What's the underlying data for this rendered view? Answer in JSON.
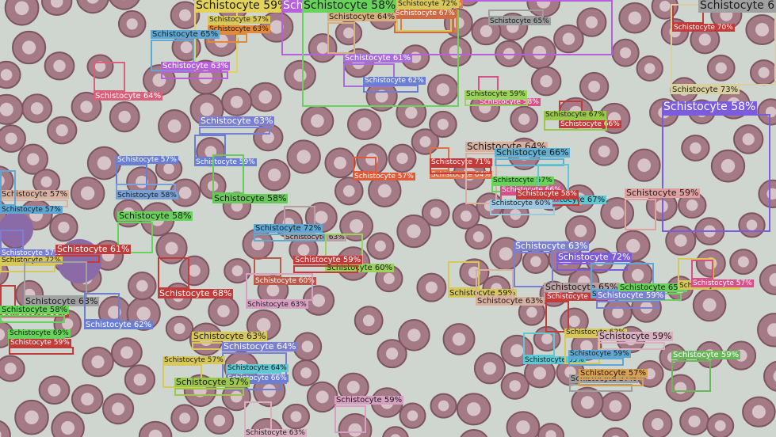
{
  "image": {
    "colors": {
      "background": "#cfd6d0",
      "cell_fill": "#a37a86",
      "cell_rim": "#7c5560",
      "cell_center": "#d7c4c8"
    },
    "detections": [
      {
        "label": "Schistocyte 57%",
        "color": "#6a7fd3"
      },
      {
        "label": "Schistocyte 59%",
        "color": "#e3d35a"
      },
      {
        "label": "Schistocyte 57%",
        "color": "#d8c85a"
      },
      {
        "label": "Schistocyte 63%",
        "color": "#e08a3a"
      },
      {
        "label": "Schistocyte 57%",
        "color": "#b85fdc"
      },
      {
        "label": "Schistocyte 58%",
        "color": "#68d35a"
      },
      {
        "label": "Schistocyte 58%",
        "color": "#e57a3d"
      },
      {
        "label": "Schistocyte 72%",
        "color": "#d8c85a"
      },
      {
        "label": "Schistocyte 67%",
        "color": "#d06a42"
      },
      {
        "label": "Schistocyte 64%",
        "color": "#d8b080"
      },
      {
        "label": "Schistocyte 65%",
        "color": "#9e9e9e"
      },
      {
        "label": "Schistocyte 65%",
        "color": "#5fa8d3"
      },
      {
        "label": "Schistocyte 63%",
        "color": "#b85fdc"
      },
      {
        "label": "Schistocyte 64%",
        "color": "#d8607a"
      },
      {
        "label": "Schistocyte 61%",
        "color": "#a86ddb"
      },
      {
        "label": "Schistocyte 62%",
        "color": "#6a7fd3"
      },
      {
        "label": "Schistocyte 58%",
        "color": "#d8508a"
      },
      {
        "label": "Schistocyte 59%",
        "color": "#9bd35a"
      },
      {
        "label": "Schistocyte 66%",
        "color": "#c23b3b"
      },
      {
        "label": "Schistocyte 67%",
        "color": "#9bc84a"
      },
      {
        "label": "Schistocyte 70%",
        "color": "#c23b3b"
      },
      {
        "label": "Schistocyte 73%",
        "color": "#d8d0a0"
      },
      {
        "label": "Schistocyte 6",
        "color": "#a0a0a0"
      },
      {
        "label": "Schistocyte 58%",
        "color": "#7a5cdc"
      },
      {
        "label": "Schistocyte 63%",
        "color": "#7a7fd3"
      },
      {
        "label": "Schistocyte 59%",
        "color": "#6a7fd3"
      },
      {
        "label": "Schistocyte 58%",
        "color": "#68c85a"
      },
      {
        "label": "Schistocyte 57%",
        "color": "#6a7fd3"
      },
      {
        "label": "Schistocyte 58%",
        "color": "#7aa0d3"
      },
      {
        "label": "Schistocyte 57%",
        "color": "#e05a3a"
      },
      {
        "label": "Schistocyte 64%",
        "color": "#e0704a"
      },
      {
        "label": "Schistocyte 71%",
        "color": "#c23b3b"
      },
      {
        "label": "Schistocyte 64%",
        "color": "#d8b0a0"
      },
      {
        "label": "Schistocyte 66%",
        "color": "#5fb0d3"
      },
      {
        "label": "Schistocyte 57%",
        "color": "#68d35a"
      },
      {
        "label": "Schistocyte 67%",
        "color": "#5fc8d3"
      },
      {
        "label": "Schistocyte 66%",
        "color": "#d8508a"
      },
      {
        "label": "Schistocyte 58%",
        "color": "#c23b3b"
      },
      {
        "label": "Schistocyte 60%",
        "color": "#9ec8e0"
      },
      {
        "label": "Schistocyte 59%",
        "color": "#e0a0a0"
      },
      {
        "label": "Schistocyte 57%",
        "color": "#d8b0a0"
      },
      {
        "label": "Schistocyte 57%",
        "color": "#5fa8d3"
      },
      {
        "label": "Schistocyte 58%",
        "color": "#68d35a"
      },
      {
        "label": "Schistocyte 57%",
        "color": "#7a7fd3"
      },
      {
        "label": "Schistocyte 61%",
        "color": "#c23b3b"
      },
      {
        "label": "Schistocyte 72%",
        "color": "#d8c85a"
      },
      {
        "label": "Schistocyte 63%",
        "color": "#b8a0a0"
      },
      {
        "label": "Schistocyte 72%",
        "color": "#5fa8d3"
      },
      {
        "label": "Schistocyte 60%",
        "color": "#9bd35a"
      },
      {
        "label": "Schistocyte 59%",
        "color": "#c23b3b"
      },
      {
        "label": "Schistocyte 60%",
        "color": "#b85a4a"
      },
      {
        "label": "Schistocyte 63%",
        "color": "#d8a0c0"
      },
      {
        "label": "Schistocyte 63%",
        "color": "#a0a0a0"
      },
      {
        "label": "Schistocyte 68%",
        "color": "#c23b3b"
      },
      {
        "label": "Schistocyte 59%",
        "color": "#c23b3b"
      },
      {
        "label": "Schistocyte 58%",
        "color": "#68d35a"
      },
      {
        "label": "Schistocyte 62%",
        "color": "#6a7fd3"
      },
      {
        "label": "Schistocyte 69%",
        "color": "#68d35a"
      },
      {
        "label": "Schistocyte 59%",
        "color": "#c23b3b"
      },
      {
        "label": "Schistocyte 63%",
        "color": "#7a7fd3"
      },
      {
        "label": "Schistocyte 72%",
        "color": "#7a5cdc"
      },
      {
        "label": "Schistocyte 59%",
        "color": "#d8c85a"
      },
      {
        "label": "Schistocyte 63%",
        "color": "#d8b0a0"
      },
      {
        "label": "Schistocyte 65%",
        "color": "#b8a0a0"
      },
      {
        "label": "Schistocyte 67%",
        "color": "#c23b3b"
      },
      {
        "label": "Schistocyte 65%",
        "color": "#5fa8d3"
      },
      {
        "label": "Schistocyte 65%",
        "color": "#68d35a"
      },
      {
        "label": "Schistocyte 59%",
        "color": "#7a7fd3"
      },
      {
        "label": "Schistocyte 71%",
        "color": "#d8c85a"
      },
      {
        "label": "Schistocyte 57%",
        "color": "#d8508a"
      },
      {
        "label": "Schistocyte 63%",
        "color": "#d8c85a"
      },
      {
        "label": "Schistocyte 64%",
        "color": "#7a7fd3"
      },
      {
        "label": "Schistocyte 57%",
        "color": "#d8c85a"
      },
      {
        "label": "Schistocyte 64%",
        "color": "#5fc8d3"
      },
      {
        "label": "Schistocyte 66%",
        "color": "#6a7fd3"
      },
      {
        "label": "Schistocyte 57%",
        "color": "#9bc84a"
      },
      {
        "label": "Schistocyte 63%",
        "color": "#d8b0c0"
      },
      {
        "label": "Schistocyte 59%",
        "color": "#d8a0c0"
      },
      {
        "label": "Schistocyte 65%",
        "color": "#5fc8d3"
      },
      {
        "label": "Schistocyte 62%",
        "color": "#d8c85a"
      },
      {
        "label": "Schistocyte 59%",
        "color": "#5fa8d3"
      },
      {
        "label": "Schistocyte 59%",
        "color": "#d8b0c0"
      },
      {
        "label": "Schistocyte 57%",
        "color": "#9e9e9e"
      },
      {
        "label": "Schistocyte 57%",
        "color": "#d8a050"
      },
      {
        "label": "Schistocyte 59%",
        "color": "#68b85a"
      }
    ]
  }
}
